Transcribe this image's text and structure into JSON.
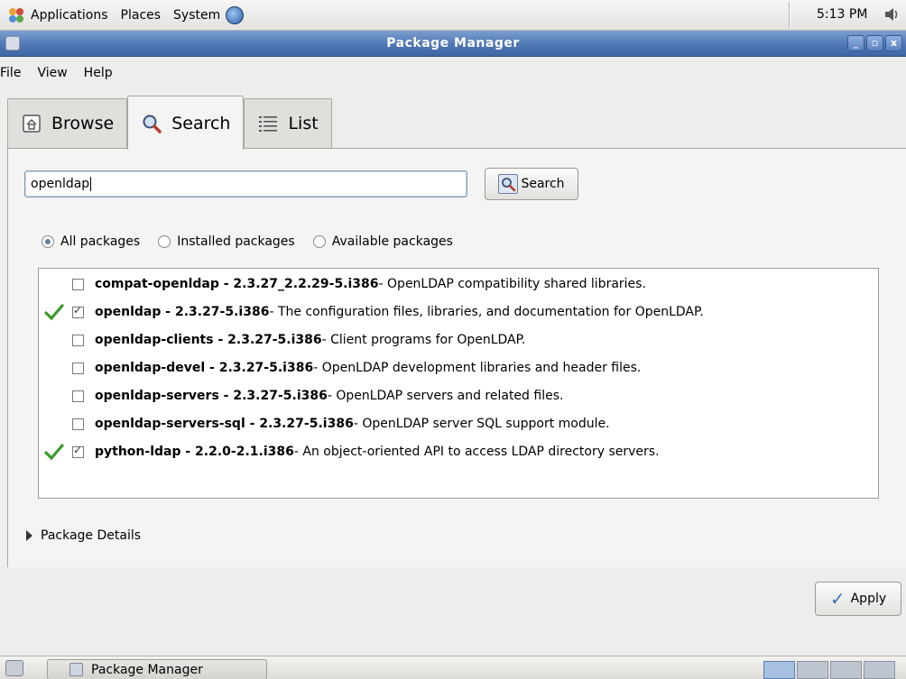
{
  "top_panel": {
    "applications": "Applications",
    "places": "Places",
    "system": "System",
    "clock": "5:13 PM"
  },
  "window": {
    "title": "Package Manager"
  },
  "menubar": {
    "file": "File",
    "view": "View",
    "help": "Help"
  },
  "tabs": [
    {
      "label": "Browse",
      "icon": "browse-icon",
      "active": false
    },
    {
      "label": "Search",
      "icon": "magnifier-icon",
      "active": true
    },
    {
      "label": "List",
      "icon": "list-icon",
      "active": false
    }
  ],
  "search": {
    "value": "openldap",
    "button_label": "Search"
  },
  "filters": {
    "all": "All packages",
    "installed": "Installed packages",
    "available": "Available packages",
    "selected": "all"
  },
  "packages": [
    {
      "name": "compat-openldap - 2.3.27_2.2.29-5.i386",
      "desc": " - OpenLDAP compatibility shared libraries.",
      "installed": false,
      "checked": false
    },
    {
      "name": "openldap - 2.3.27-5.i386",
      "desc": " - The configuration files, libraries, and documentation for OpenLDAP.",
      "installed": true,
      "checked": true
    },
    {
      "name": "openldap-clients - 2.3.27-5.i386",
      "desc": " - Client programs for OpenLDAP.",
      "installed": false,
      "checked": false
    },
    {
      "name": "openldap-devel - 2.3.27-5.i386",
      "desc": " - OpenLDAP development libraries and header files.",
      "installed": false,
      "checked": false
    },
    {
      "name": "openldap-servers - 2.3.27-5.i386",
      "desc": " - OpenLDAP servers and related files.",
      "installed": false,
      "checked": false
    },
    {
      "name": "openldap-servers-sql - 2.3.27-5.i386",
      "desc": " - OpenLDAP server SQL support module.",
      "installed": false,
      "checked": false
    },
    {
      "name": "python-ldap - 2.2.0-2.1.i386",
      "desc": " - An object-oriented API to access LDAP directory servers.",
      "installed": true,
      "checked": true
    }
  ],
  "details": {
    "label": "Package Details"
  },
  "apply": {
    "label": "Apply"
  },
  "taskbar": {
    "window_button": "Package Manager"
  },
  "colors": {
    "titlebar": "#4f77b4",
    "install_check": "#3a9a2a"
  }
}
